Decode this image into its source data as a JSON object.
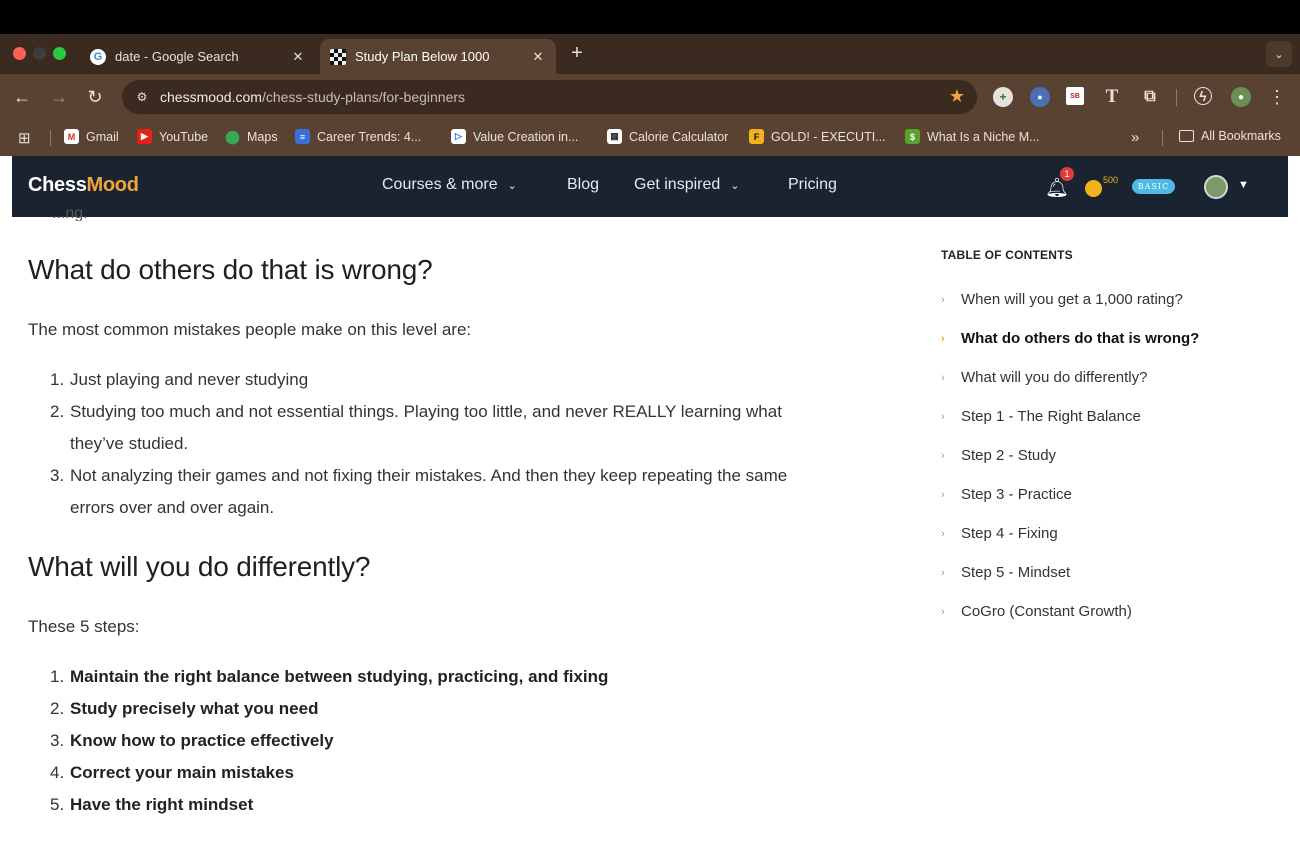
{
  "browser": {
    "tabs": [
      {
        "title": "date - Google Search",
        "close": "✕"
      },
      {
        "title": "Study Plan Below 1000",
        "close": "✕"
      }
    ],
    "new_tab": "+",
    "tab_search": "⌄",
    "url_host": "chessmood.com",
    "url_path": "/chess-study-plans/for-beginners",
    "bookmarks": [
      {
        "label": "Gmail"
      },
      {
        "label": "YouTube"
      },
      {
        "label": "Maps"
      },
      {
        "label": "Career Trends: 4..."
      },
      {
        "label": "Value Creation in..."
      },
      {
        "label": "Calorie Calculator"
      },
      {
        "label": "GOLD! - EXECUTI..."
      },
      {
        "label": "What Is a Niche M..."
      }
    ],
    "bookmarks_more": "»",
    "all_bookmarks": "All Bookmarks"
  },
  "site": {
    "logo_main": "Chess",
    "logo_accent": "Mood",
    "nav": [
      {
        "label": "Courses & more"
      },
      {
        "label": "Blog"
      },
      {
        "label": "Get inspired"
      },
      {
        "label": "Pricing"
      }
    ],
    "notification_count": "1",
    "coins": "500",
    "plan": "BASIC"
  },
  "article": {
    "cut_text": "...ng.",
    "heading1": "What do others do that is wrong?",
    "intro1": "The most common mistakes people make on this level are:",
    "mistakes": [
      {
        "num": "1.",
        "text": "Just playing and never studying"
      },
      {
        "num": "2.",
        "text": "Studying too much and not essential things. Playing too little, and never REALLY learning what they’ve studied."
      },
      {
        "num": "3.",
        "text": "Not analyzing their games and not fixing their mistakes. And then they keep repeating the same errors over and over again."
      }
    ],
    "heading2": "What will you do differently?",
    "intro2": "These 5 steps:",
    "steps": [
      {
        "num": "1.",
        "text": "Maintain the right balance between studying, practicing, and fixing"
      },
      {
        "num": "2.",
        "text": "Study precisely what you need"
      },
      {
        "num": "3.",
        "text": "Know how to practice effectively"
      },
      {
        "num": "4.",
        "text": "Correct your main mistakes"
      },
      {
        "num": "5.",
        "text": "Have the right mindset"
      }
    ]
  },
  "toc": {
    "title": "TABLE OF CONTENTS",
    "items": [
      {
        "label": "When will you get a 1,000 rating?"
      },
      {
        "label": "What do others do that is wrong?"
      },
      {
        "label": "What will you do differently?"
      },
      {
        "label": "Step 1 - The Right Balance"
      },
      {
        "label": "Step 2 - Study"
      },
      {
        "label": "Step 3 - Practice"
      },
      {
        "label": "Step 4 - Fixing"
      },
      {
        "label": "Step 5 - Mindset"
      },
      {
        "label": "CoGro (Constant Growth)"
      }
    ],
    "active_index": 1
  }
}
